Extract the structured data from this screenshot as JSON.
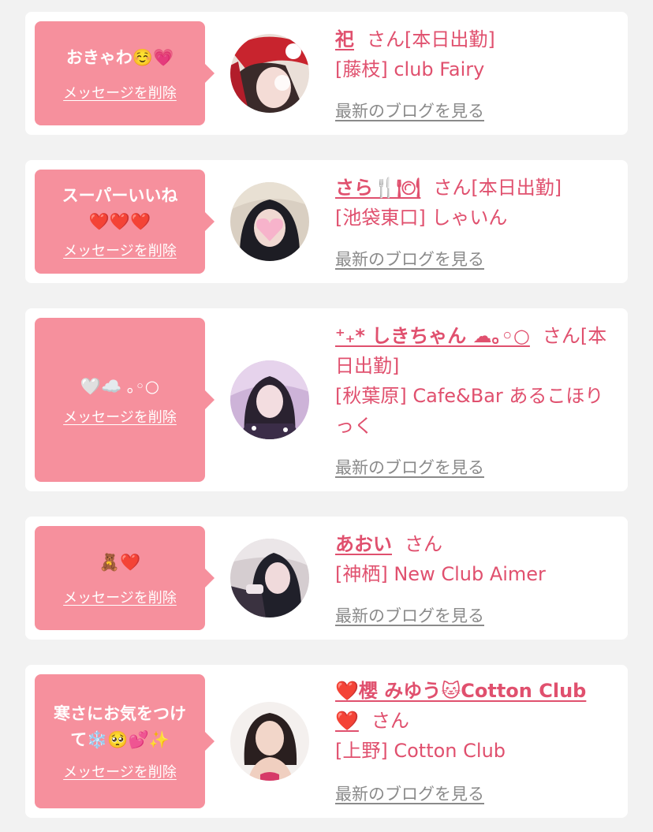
{
  "delete_label": "メッセージを削除",
  "blog_label": "最新のブログを見る",
  "honorific": "さん",
  "colors": {
    "bubble": "#f6909d",
    "accent_text": "#e0506e",
    "link_gray": "#8a8a8a",
    "card": "#ffffff",
    "background": "#f2f2f2"
  },
  "cards": [
    {
      "message": "おきゃわ☺️💗",
      "name": "祀",
      "status": "[本日出勤]",
      "shop": "[藤枝] club Fairy"
    },
    {
      "message": "スーパーいいね",
      "message2": "❤️❤️❤️",
      "name": "さら🍴🍽",
      "status": "[本日出勤]",
      "shop": "[池袋東口] しゃいん"
    },
    {
      "message": "🤍☁️ ｡◦○",
      "name": "⁺₊* しきちゃん ☁︎｡◦○",
      "status": "[本日出勤]",
      "shop": "[秋葉原] Cafe&Bar あるこほりっく"
    },
    {
      "message": "🧸❤️",
      "name": "あおい",
      "status": "",
      "shop": "[神栖] New Club Aimer"
    },
    {
      "message": "寒さにお気をつけ",
      "message2": "て❄️🥺💕✨",
      "name": "❤️櫻 みゆう🐱Cotton Club ❤️",
      "status": "",
      "shop": "[上野] Cotton Club"
    }
  ]
}
